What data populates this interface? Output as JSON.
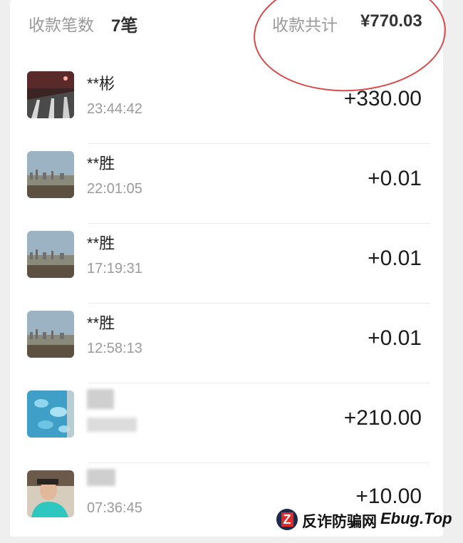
{
  "summary": {
    "count_label": "收款笔数",
    "count_value": "7笔",
    "total_label": "收款共计",
    "total_value": "¥770.03"
  },
  "transactions": [
    {
      "name": "**彬",
      "time": "23:44:42",
      "amount": "+330.00",
      "avatar": "road-night"
    },
    {
      "name": "**胜",
      "time": "22:01:05",
      "amount": "+0.01",
      "avatar": "city-skyline"
    },
    {
      "name": "**胜",
      "time": "17:19:31",
      "amount": "+0.01",
      "avatar": "city-skyline"
    },
    {
      "name": "**胜",
      "time": "12:58:13",
      "amount": "+0.01",
      "avatar": "city-skyline"
    },
    {
      "name": "",
      "time": "",
      "amount": "+210.00",
      "avatar": "butterfly-blue"
    },
    {
      "name": "",
      "time": "07:36:45",
      "amount": "+10.00",
      "avatar": "person-photo"
    }
  ],
  "watermark": {
    "logo_letter": "Z",
    "cn_text": "反诈防骗网",
    "en_text": "Ebug.Top"
  },
  "colors": {
    "annotation_circle": "#d94a4a",
    "secondary_text": "#9a9a9a"
  }
}
